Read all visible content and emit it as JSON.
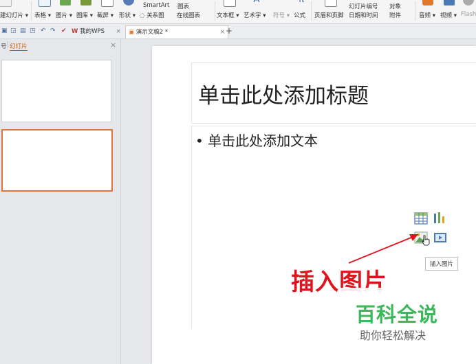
{
  "ribbon": {
    "items": [
      {
        "label": "建幻灯片 ▾",
        "icon": "new-slide-icon"
      },
      {
        "label": "表格 ▾",
        "icon": "table-icon"
      },
      {
        "label": "图片 ▾",
        "icon": "picture-icon"
      },
      {
        "label": "图库 ▾",
        "icon": "gallery-icon"
      },
      {
        "label": "截屏 ▾",
        "icon": "screenshot-icon"
      },
      {
        "label": "形状 ▾",
        "icon": "shape-icon"
      },
      {
        "label": "◌ 关系图",
        "icon": "relation-icon"
      },
      {
        "label": "SmartArt",
        "icon": "smartart-icon"
      },
      {
        "label": "图表",
        "icon": "chart-icon"
      },
      {
        "label": "在线图表",
        "icon": "online-chart-icon"
      },
      {
        "label": "文本框 ▾",
        "icon": "textbox-icon"
      },
      {
        "label": "艺术字 ▾",
        "icon": "wordart-icon"
      },
      {
        "label": "符号 ▾",
        "icon": "symbol-icon"
      },
      {
        "label": "公式",
        "icon": "formula-icon"
      },
      {
        "label": "页眉和页脚",
        "icon": "header-footer-icon"
      },
      {
        "label": "幻灯片编号",
        "icon": "slide-number-icon"
      },
      {
        "label": "对象",
        "icon": "object-icon"
      },
      {
        "label": "日期和时间",
        "icon": "datetime-icon"
      },
      {
        "label": "附件",
        "icon": "attachment-icon"
      },
      {
        "label": "音频 ▾",
        "icon": "audio-icon"
      },
      {
        "label": "视频 ▾",
        "icon": "video-icon"
      },
      {
        "label": "Flash",
        "icon": "flash-icon"
      }
    ]
  },
  "tabs": {
    "home": "我的WPS",
    "doc": "演示文稿2 *",
    "add": "+",
    "close": "×"
  },
  "left_pane": {
    "outline_tab": "号",
    "slides_tab": "幻灯片",
    "close": "×"
  },
  "slide": {
    "title_placeholder": "单击此处添加标题",
    "body_placeholder": "• 单击此处添加文本"
  },
  "tooltip": "插入图片",
  "annotation": "插入图片",
  "watermark": {
    "title": "百科全说",
    "subtitle": "助你轻松解决"
  },
  "colors": {
    "accent": "#e0743a",
    "annotation_red": "#e0141e",
    "watermark_green": "#3cb85a"
  }
}
